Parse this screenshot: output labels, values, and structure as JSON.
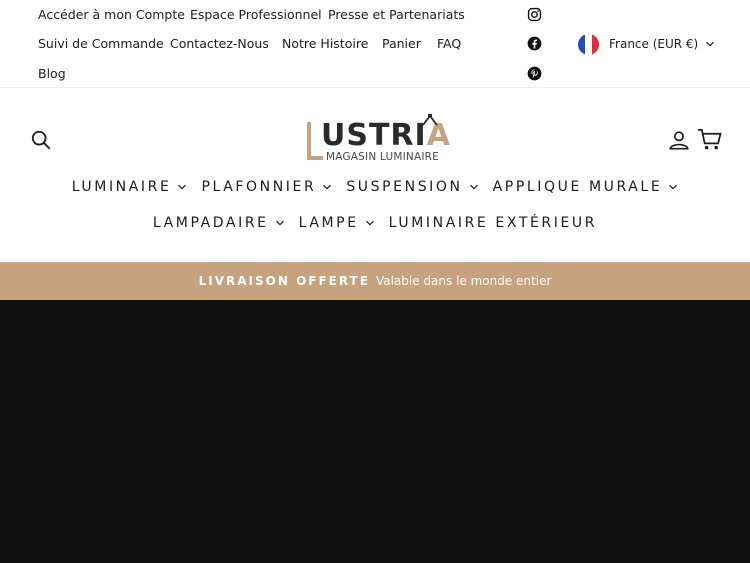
{
  "topbar": {
    "links_row1": [
      "Accéder à mon Compte",
      "Espace Professionnel",
      "Presse et Partenariats"
    ],
    "links_row2": [
      "Suivi de Commande",
      "Contactez-Nous",
      "Notre Histoire",
      "Panier",
      "FAQ"
    ],
    "links_row3": [
      "Blog"
    ],
    "social": [
      "instagram-icon",
      "facebook-icon",
      "pinterest-icon"
    ],
    "locale": {
      "label": "France (EUR €)",
      "flag_colors": [
        "#1f4fbf",
        "#ffffff",
        "#e5293a"
      ]
    }
  },
  "header": {
    "logo": {
      "word_main": "USTRI",
      "word_accent": "A",
      "subtitle": "MAGASIN LUMINAIRE"
    },
    "icons": [
      "search-icon",
      "account-icon",
      "cart-icon"
    ],
    "nav_row1": [
      "LUMINAIRE",
      "PLAFONNIER",
      "SUSPENSION",
      "APPLIQUE MURALE"
    ],
    "nav_row2": [
      "LAMPADAIRE",
      "LAMPE",
      "LUMINAIRE EXTÉRIEUR"
    ],
    "nav_row2_has_chevron": [
      true,
      true,
      false
    ]
  },
  "promo": {
    "strong": "LIVRAISON OFFERTE",
    "light": "Valable dans le monde entier"
  },
  "colors": {
    "accent": "#c6a27f",
    "hero_bg": "#111111",
    "text": "#1c1d1d"
  }
}
